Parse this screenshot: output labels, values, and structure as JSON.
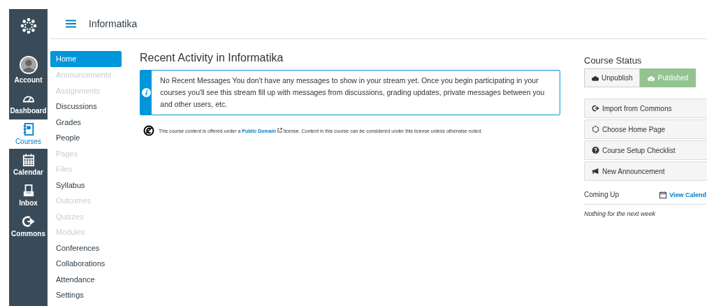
{
  "global_nav": [
    {
      "kind": "account",
      "label": "Account",
      "selected": false
    },
    {
      "kind": "dashboard",
      "label": "Dashboard",
      "selected": false
    },
    {
      "kind": "courses",
      "label": "Courses",
      "selected": true
    },
    {
      "kind": "calendar",
      "label": "Calendar",
      "selected": false
    },
    {
      "kind": "inbox",
      "label": "Inbox",
      "selected": false
    },
    {
      "kind": "commons",
      "label": "Commons",
      "selected": false
    }
  ],
  "header": {
    "title": "Informatika"
  },
  "course_nav": [
    {
      "label": "Home",
      "selected": true,
      "disabled": false
    },
    {
      "label": "Announcements",
      "selected": false,
      "disabled": true
    },
    {
      "label": "Assignments",
      "selected": false,
      "disabled": true
    },
    {
      "label": "Discussions",
      "selected": false,
      "disabled": false
    },
    {
      "label": "Grades",
      "selected": false,
      "disabled": false
    },
    {
      "label": "People",
      "selected": false,
      "disabled": false
    },
    {
      "label": "Pages",
      "selected": false,
      "disabled": true
    },
    {
      "label": "Files",
      "selected": false,
      "disabled": true
    },
    {
      "label": "Syllabus",
      "selected": false,
      "disabled": false
    },
    {
      "label": "Outcomes",
      "selected": false,
      "disabled": true
    },
    {
      "label": "Quizzes",
      "selected": false,
      "disabled": true
    },
    {
      "label": "Modules",
      "selected": false,
      "disabled": true
    },
    {
      "label": "Conferences",
      "selected": false,
      "disabled": false
    },
    {
      "label": "Collaborations",
      "selected": false,
      "disabled": false
    },
    {
      "label": "Attendance",
      "selected": false,
      "disabled": false
    },
    {
      "label": "Settings",
      "selected": false,
      "disabled": false
    }
  ],
  "main": {
    "title": "Recent Activity in Informatika",
    "alert": "No Recent Messages  You don't have any messages to show in your stream yet. Once you begin participating in your courses you'll see this stream fill up with messages from discussions, grading updates, private messages between you and other users, etc.",
    "license": {
      "before": "This course content is offered under a",
      "link": "Public Domain",
      "after": "license. Content in this course can be considered under this license unless otherwise noted."
    }
  },
  "sidebar": {
    "title": "Course Status",
    "status_buttons": [
      {
        "kind": "unpublish",
        "label": "Unpublish",
        "selected": false
      },
      {
        "kind": "published",
        "label": "Published",
        "selected": true
      }
    ],
    "actions": [
      {
        "kind": "import",
        "label": "Import from Commons"
      },
      {
        "kind": "home",
        "label": "Choose Home Page"
      },
      {
        "kind": "checklist",
        "label": "Course Setup Checklist"
      },
      {
        "kind": "announcement",
        "label": "New Announcement"
      }
    ],
    "coming_up": {
      "title": "Coming Up",
      "link": "View Calend",
      "empty": "Nothing for the next week"
    }
  }
}
